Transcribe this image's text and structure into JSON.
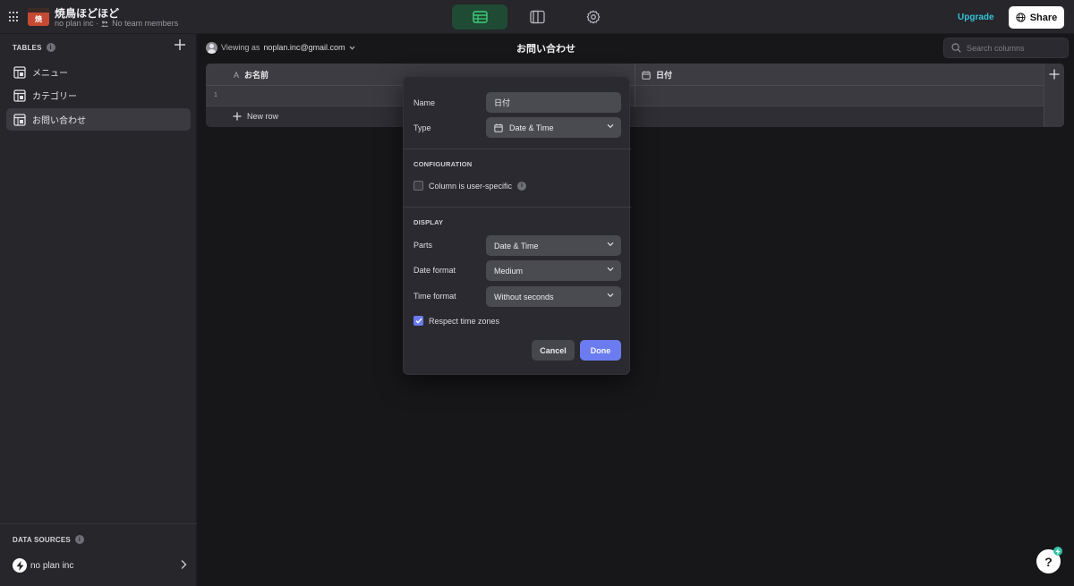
{
  "app": {
    "name": "焼鳥ほどほど",
    "logo_glyph": "焼",
    "org": "no plan inc",
    "team_text": "No team members",
    "upgrade_label": "Upgrade",
    "share_label": "Share",
    "mode_tabs": [
      {
        "name": "data-editor",
        "icon": "table-icon",
        "active": true
      },
      {
        "name": "layout-editor",
        "icon": "device-layout-icon",
        "active": false
      },
      {
        "name": "settings",
        "icon": "gear-icon",
        "active": false
      }
    ]
  },
  "sidebar": {
    "tables_heading": "TABLES",
    "tables": [
      {
        "label": "メニュー",
        "active": false
      },
      {
        "label": "カテゴリー",
        "active": false
      },
      {
        "label": "お問い合わせ",
        "active": true
      }
    ],
    "data_sources_heading": "DATA SOURCES",
    "data_source": "no plan inc"
  },
  "main": {
    "viewing_prefix": "Viewing as",
    "viewing_user": "noplan.inc@gmail.com",
    "title": "お問い合わせ",
    "search_placeholder": "Search columns",
    "columns": [
      {
        "type_icon": "text-type-icon",
        "type_glyph": "A",
        "label": "お名前"
      },
      {
        "type_icon": "calendar-icon",
        "type_glyph": "",
        "label": "日付"
      }
    ],
    "rows": [
      {
        "num": "1"
      }
    ],
    "new_row_label": "New row"
  },
  "column_editor": {
    "name_label": "Name",
    "name_value": "日付",
    "type_label": "Type",
    "type_value": "Date & Time",
    "configuration_heading": "CONFIGURATION",
    "user_specific_label": "Column is user-specific",
    "user_specific_checked": false,
    "display_heading": "DISPLAY",
    "parts_label": "Parts",
    "parts_value": "Date & Time",
    "date_format_label": "Date format",
    "date_format_value": "Medium",
    "time_format_label": "Time format",
    "time_format_value": "Without seconds",
    "respect_tz_label": "Respect time zones",
    "respect_tz_checked": true,
    "cancel_label": "Cancel",
    "done_label": "Done"
  },
  "help": {
    "label": "?"
  },
  "colors": {
    "accent": "#6b7cf0",
    "upgrade": "#36c2d6",
    "active_mode": "#1f4a33",
    "mode_icon_active": "#3ecf7a"
  }
}
